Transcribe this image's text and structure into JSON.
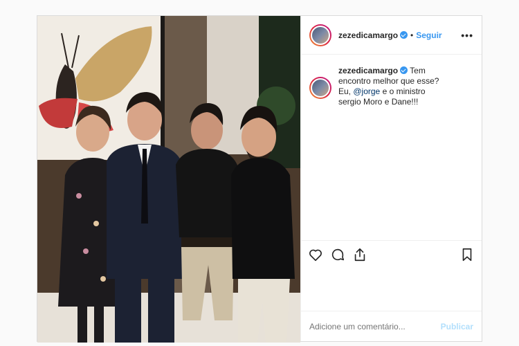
{
  "post": {
    "username": "zezedicamargo",
    "separator": "•",
    "follow_label": "Seguir",
    "more_label": "•••",
    "caption": {
      "username": "zezedicamargo",
      "text_before": " Tem encontro melhor que esse? Eu, ",
      "mention": "@jorge",
      "text_after": " e o ministro sergio Moro e Dane!!!"
    },
    "comment_placeholder": "Adicione um comentário...",
    "publish_label": "Publicar"
  }
}
